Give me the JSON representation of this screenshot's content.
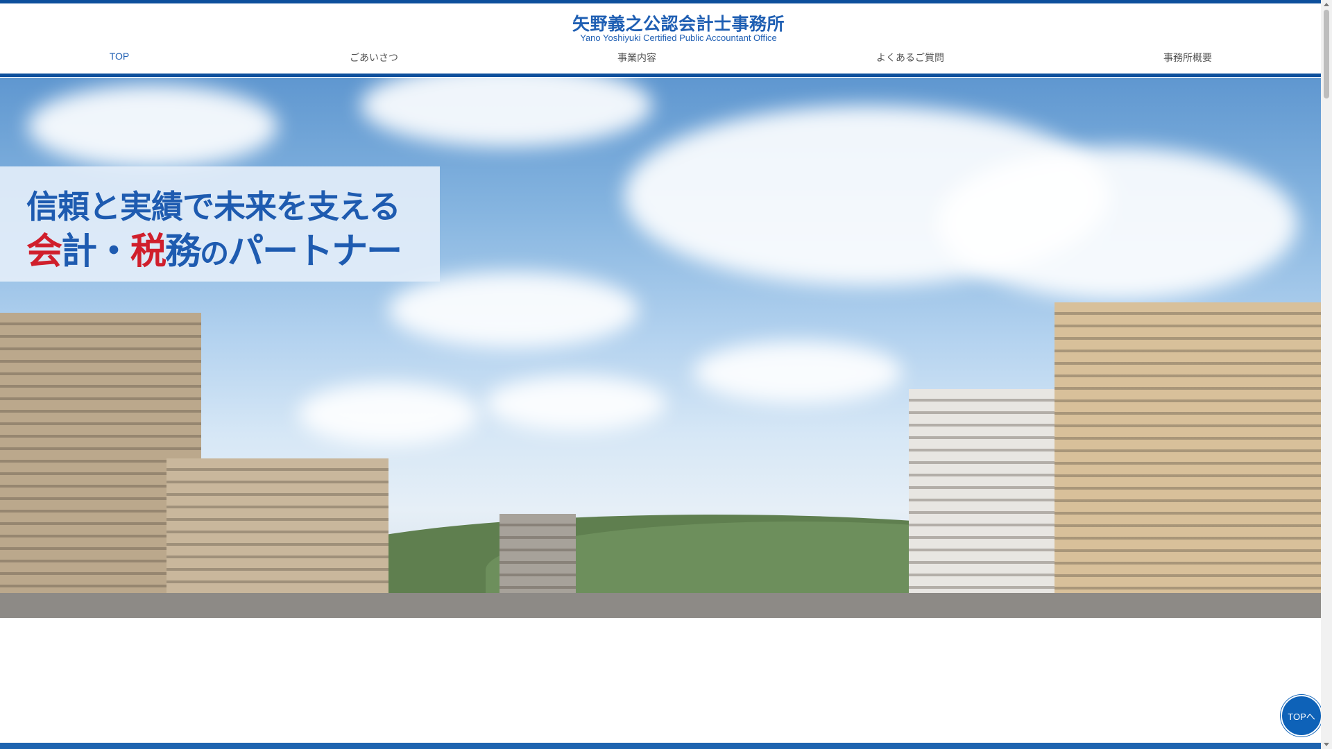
{
  "header": {
    "title": "矢野義之公認会計士事務所",
    "subtitle": "Yano Yoshiyuki Certified Public Accountant Office"
  },
  "nav": {
    "items": [
      {
        "label": "TOP",
        "active": true
      },
      {
        "label": "ごあいさつ"
      },
      {
        "label": "事業内容"
      },
      {
        "label": "よくあるご質問"
      },
      {
        "label": "事務所概要"
      }
    ]
  },
  "hero": {
    "line1": "信頼と実績で未来を支える",
    "line2": {
      "kai": "会",
      "kei": "計・",
      "zei": "税",
      "mu": "務",
      "no": "の",
      "partner": "パートナー"
    },
    "image": "city skyline with blue sky and clouds"
  },
  "floating": {
    "top_button_label": "TOPへ"
  },
  "colors": {
    "brand_blue": "#1f5fb3",
    "accent_red": "#d01f2c",
    "stripe_blue": "#0d4f9c"
  }
}
